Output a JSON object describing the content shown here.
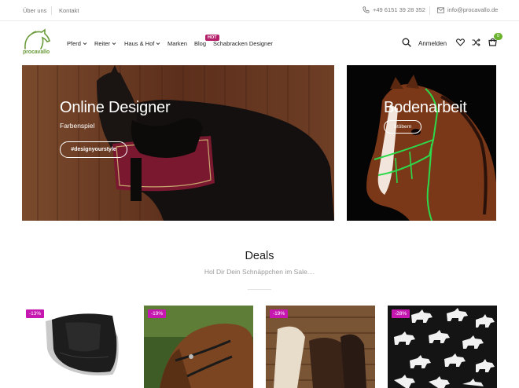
{
  "topbar": {
    "links": [
      "Über uns",
      "Kontakt"
    ],
    "phone": "+49 6151 39 28 352",
    "email": "info@procavallo.de"
  },
  "header": {
    "logo_text": "procavallo",
    "nav": [
      {
        "label": "Pferd",
        "has_dropdown": true
      },
      {
        "label": "Reiter",
        "has_dropdown": true
      },
      {
        "label": "Haus & Hof",
        "has_dropdown": true
      },
      {
        "label": "Marken",
        "has_dropdown": false
      },
      {
        "label": "Blog",
        "has_dropdown": false
      },
      {
        "label": "Schabracken Designer",
        "has_dropdown": false
      }
    ],
    "hot_badge": "HOT",
    "login_label": "Anmelden",
    "cart_count": "0",
    "icons": [
      "search-icon",
      "heart-icon",
      "shuffle-icon",
      "cart-icon"
    ]
  },
  "banners": [
    {
      "title": "Online Designer",
      "subtitle": "Farbenspiel",
      "button": "#designyourstyle"
    },
    {
      "title": "Bodenarbeit",
      "button": "Stöbern"
    }
  ],
  "deals": {
    "title": "Deals",
    "subtitle": "Hol Dir Dein Schnäppchen im Sale....",
    "products": [
      {
        "discount": "-13%"
      },
      {
        "discount": "-19%"
      },
      {
        "discount": "-19%"
      },
      {
        "discount": "-28%"
      }
    ]
  },
  "colors": {
    "accent_green": "#6bb32e",
    "hot_badge": "#b5206b",
    "discount_badge": "#c617b0"
  }
}
